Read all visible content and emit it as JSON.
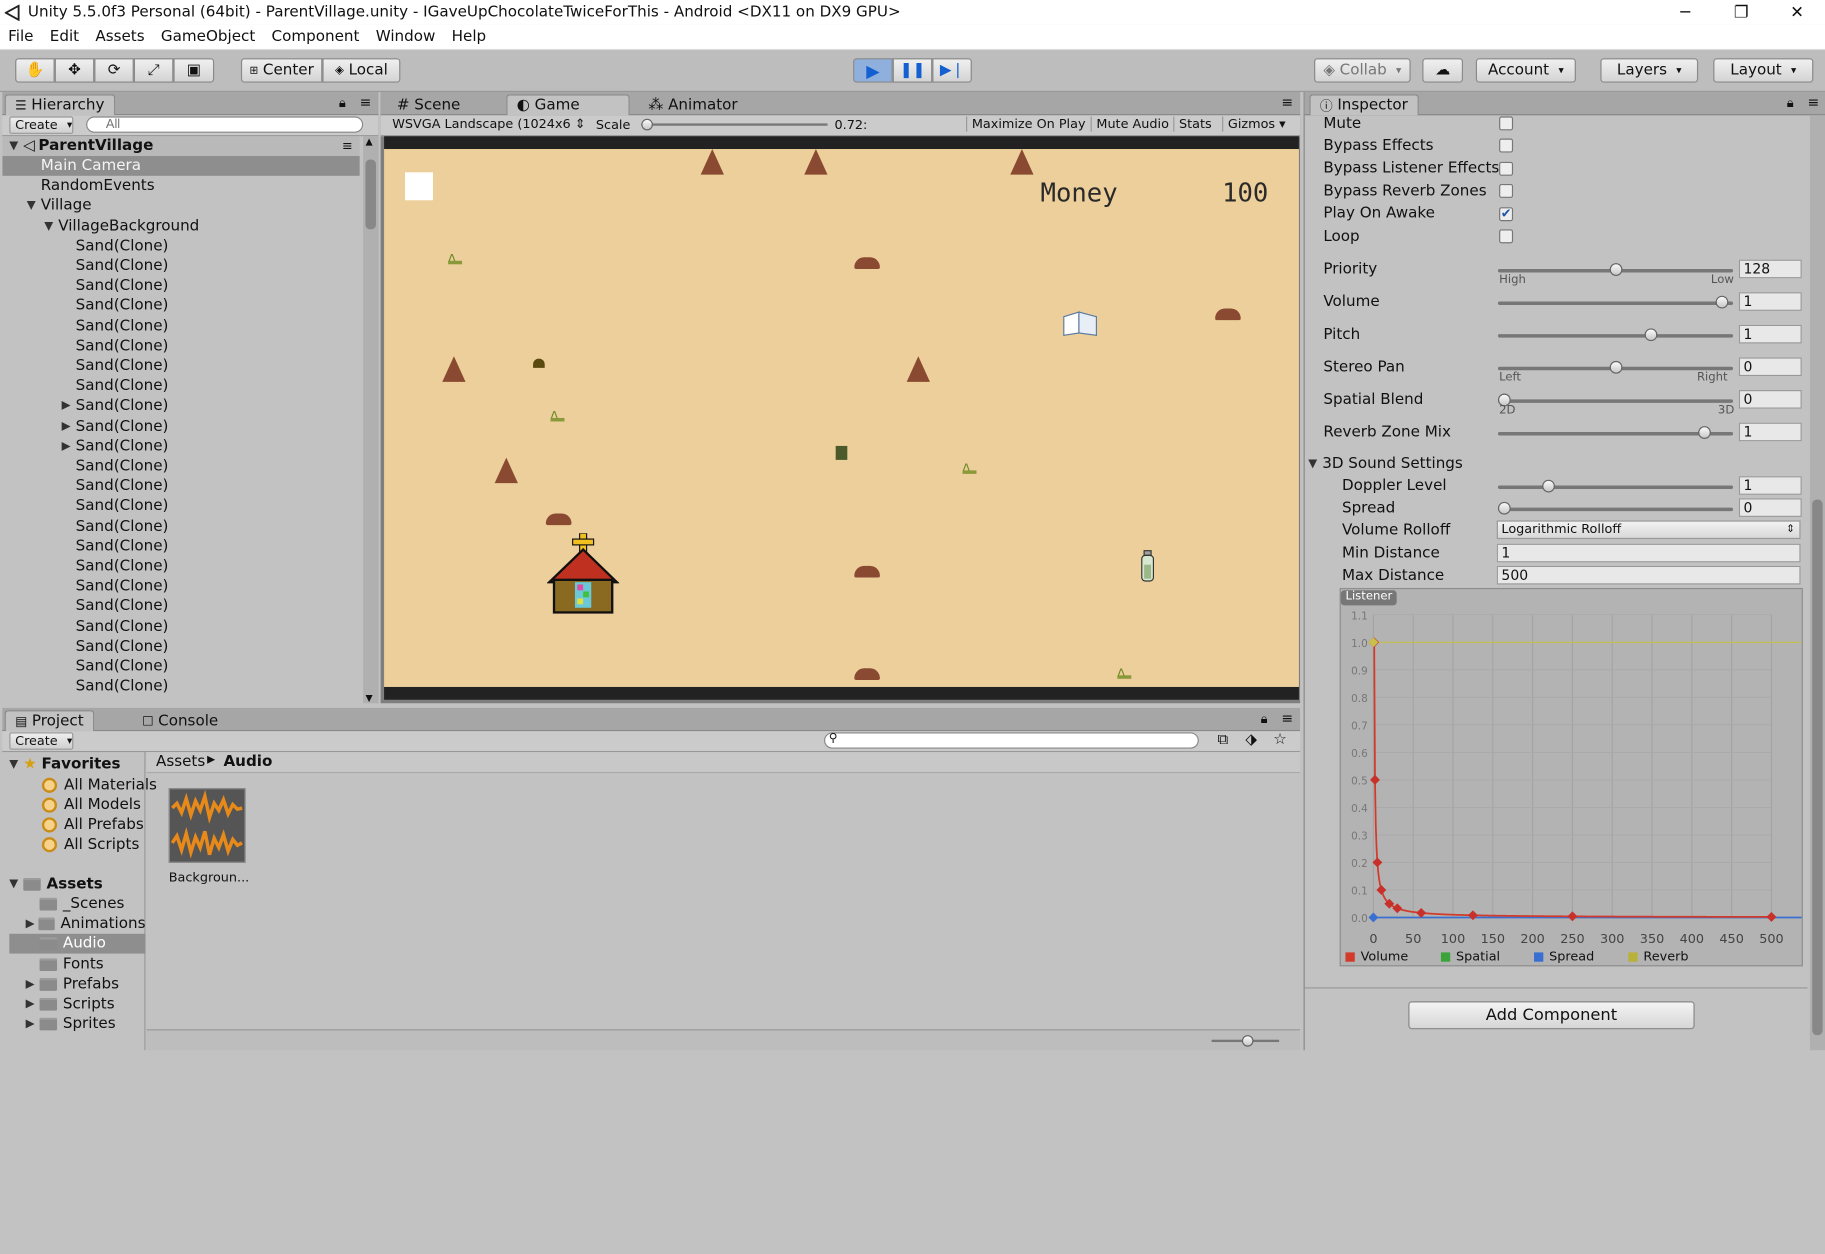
{
  "window": {
    "title": "Unity 5.5.0f3 Personal (64bit) - ParentVillage.unity - IGaveUpChocolateTwiceForThis - Android <DX11 on DX9 GPU>"
  },
  "menu": [
    "File",
    "Edit",
    "Assets",
    "GameObject",
    "Component",
    "Window",
    "Help"
  ],
  "toolbar": {
    "pivot": "Center",
    "space": "Local",
    "collab": "Collab",
    "account": "Account",
    "layers": "Layers",
    "layout": "Layout"
  },
  "hierarchy": {
    "tab": "Hierarchy",
    "create": "Create",
    "search_placeholder": "All",
    "scene": "ParentVillage",
    "rows": [
      {
        "label": "Main Camera",
        "indent": 1,
        "selected": true,
        "arrow": ""
      },
      {
        "label": "RandomEvents",
        "indent": 1,
        "arrow": ""
      },
      {
        "label": "Village",
        "indent": 1,
        "arrow": "down"
      },
      {
        "label": "VillageBackground",
        "indent": 2,
        "arrow": "down"
      },
      {
        "label": "Sand(Clone)",
        "indent": 3,
        "arrow": ""
      },
      {
        "label": "Sand(Clone)",
        "indent": 3,
        "arrow": ""
      },
      {
        "label": "Sand(Clone)",
        "indent": 3,
        "arrow": ""
      },
      {
        "label": "Sand(Clone)",
        "indent": 3,
        "arrow": ""
      },
      {
        "label": "Sand(Clone)",
        "indent": 3,
        "arrow": ""
      },
      {
        "label": "Sand(Clone)",
        "indent": 3,
        "arrow": ""
      },
      {
        "label": "Sand(Clone)",
        "indent": 3,
        "arrow": ""
      },
      {
        "label": "Sand(Clone)",
        "indent": 3,
        "arrow": ""
      },
      {
        "label": "Sand(Clone)",
        "indent": 3,
        "arrow": "right"
      },
      {
        "label": "Sand(Clone)",
        "indent": 3,
        "arrow": "right"
      },
      {
        "label": "Sand(Clone)",
        "indent": 3,
        "arrow": "right"
      },
      {
        "label": "Sand(Clone)",
        "indent": 3,
        "arrow": ""
      },
      {
        "label": "Sand(Clone)",
        "indent": 3,
        "arrow": ""
      },
      {
        "label": "Sand(Clone)",
        "indent": 3,
        "arrow": ""
      },
      {
        "label": "Sand(Clone)",
        "indent": 3,
        "arrow": ""
      },
      {
        "label": "Sand(Clone)",
        "indent": 3,
        "arrow": ""
      },
      {
        "label": "Sand(Clone)",
        "indent": 3,
        "arrow": ""
      },
      {
        "label": "Sand(Clone)",
        "indent": 3,
        "arrow": ""
      },
      {
        "label": "Sand(Clone)",
        "indent": 3,
        "arrow": ""
      },
      {
        "label": "Sand(Clone)",
        "indent": 3,
        "arrow": ""
      },
      {
        "label": "Sand(Clone)",
        "indent": 3,
        "arrow": ""
      },
      {
        "label": "Sand(Clone)",
        "indent": 3,
        "arrow": ""
      },
      {
        "label": "Sand(Clone)",
        "indent": 3,
        "arrow": ""
      }
    ]
  },
  "center_tabs": {
    "scene": "Scene",
    "game": "Game",
    "animator": "Animator"
  },
  "game_bar": {
    "resolution": "WSVGA Landscape (1024x6",
    "scale_label": "Scale",
    "scale_value": "0.72:",
    "maximize": "Maximize On Play",
    "mute": "Mute Audio",
    "stats": "Stats",
    "gizmos": "Gizmos"
  },
  "game": {
    "money_label": "Money",
    "money_value": "100"
  },
  "project": {
    "tab": "Project",
    "console_tab": "Console",
    "create": "Create",
    "favorites": "Favorites",
    "fav_items": [
      "All Materials",
      "All Models",
      "All Prefabs",
      "All Scripts"
    ],
    "assets": "Assets",
    "asset_folders": [
      {
        "label": "_Scenes",
        "arrow": ""
      },
      {
        "label": "Animations",
        "arrow": "right"
      },
      {
        "label": "Audio",
        "arrow": "",
        "selected": true
      },
      {
        "label": "Fonts",
        "arrow": ""
      },
      {
        "label": "Prefabs",
        "arrow": "right"
      },
      {
        "label": "Scripts",
        "arrow": "right"
      },
      {
        "label": "Sprites",
        "arrow": "right"
      }
    ],
    "breadcrumb": [
      "Assets",
      "Audio"
    ],
    "file_label": "Backgroun..."
  },
  "inspector": {
    "tab": "Inspector",
    "checkboxes": [
      {
        "label": "Mute",
        "checked": false
      },
      {
        "label": "Bypass Effects",
        "checked": false
      },
      {
        "label": "Bypass Listener Effects",
        "checked": false
      },
      {
        "label": "Bypass Reverb Zones",
        "checked": false
      },
      {
        "label": "Play On Awake",
        "checked": true
      },
      {
        "label": "Loop",
        "checked": false
      }
    ],
    "sliders": [
      {
        "label": "Priority",
        "value": "128",
        "fraction": 0.5,
        "low_label": "High",
        "high_label": "Low"
      },
      {
        "label": "Volume",
        "value": "1",
        "fraction": 0.98
      },
      {
        "label": "Pitch",
        "value": "1",
        "fraction": 0.66
      },
      {
        "label": "Stereo Pan",
        "value": "0",
        "fraction": 0.5,
        "low_label": "Left",
        "high_label": "Right"
      },
      {
        "label": "Spatial Blend",
        "value": "0",
        "fraction": 0.0,
        "low_label": "2D",
        "high_label": "3D"
      },
      {
        "label": "Reverb Zone Mix",
        "value": "1",
        "fraction": 0.9
      }
    ],
    "sound3d": {
      "header": "3D Sound Settings",
      "doppler": {
        "label": "Doppler Level",
        "value": "1",
        "fraction": 0.2
      },
      "spread": {
        "label": "Spread",
        "value": "0",
        "fraction": 0.0
      },
      "rolloff": {
        "label": "Volume Rolloff",
        "value": "Logarithmic Rolloff"
      },
      "min": {
        "label": "Min Distance",
        "value": "1"
      },
      "max": {
        "label": "Max Distance",
        "value": "500"
      }
    },
    "graph": {
      "listener_label": "Listener",
      "y_ticks": [
        "1.1",
        "1.0",
        "0.9",
        "0.8",
        "0.7",
        "0.6",
        "0.5",
        "0.4",
        "0.3",
        "0.2",
        "0.1",
        "0.0"
      ],
      "x_ticks": [
        "0",
        "50",
        "100",
        "150",
        "200",
        "250",
        "300",
        "350",
        "400",
        "450",
        "500"
      ],
      "legend": [
        {
          "label": "Volume",
          "color": "#d23a2a"
        },
        {
          "label": "Spatial",
          "color": "#3aa33a"
        },
        {
          "label": "Spread",
          "color": "#3a6fd2"
        },
        {
          "label": "Reverb",
          "color": "#b8b23a"
        }
      ]
    },
    "add_component": "Add Component"
  }
}
